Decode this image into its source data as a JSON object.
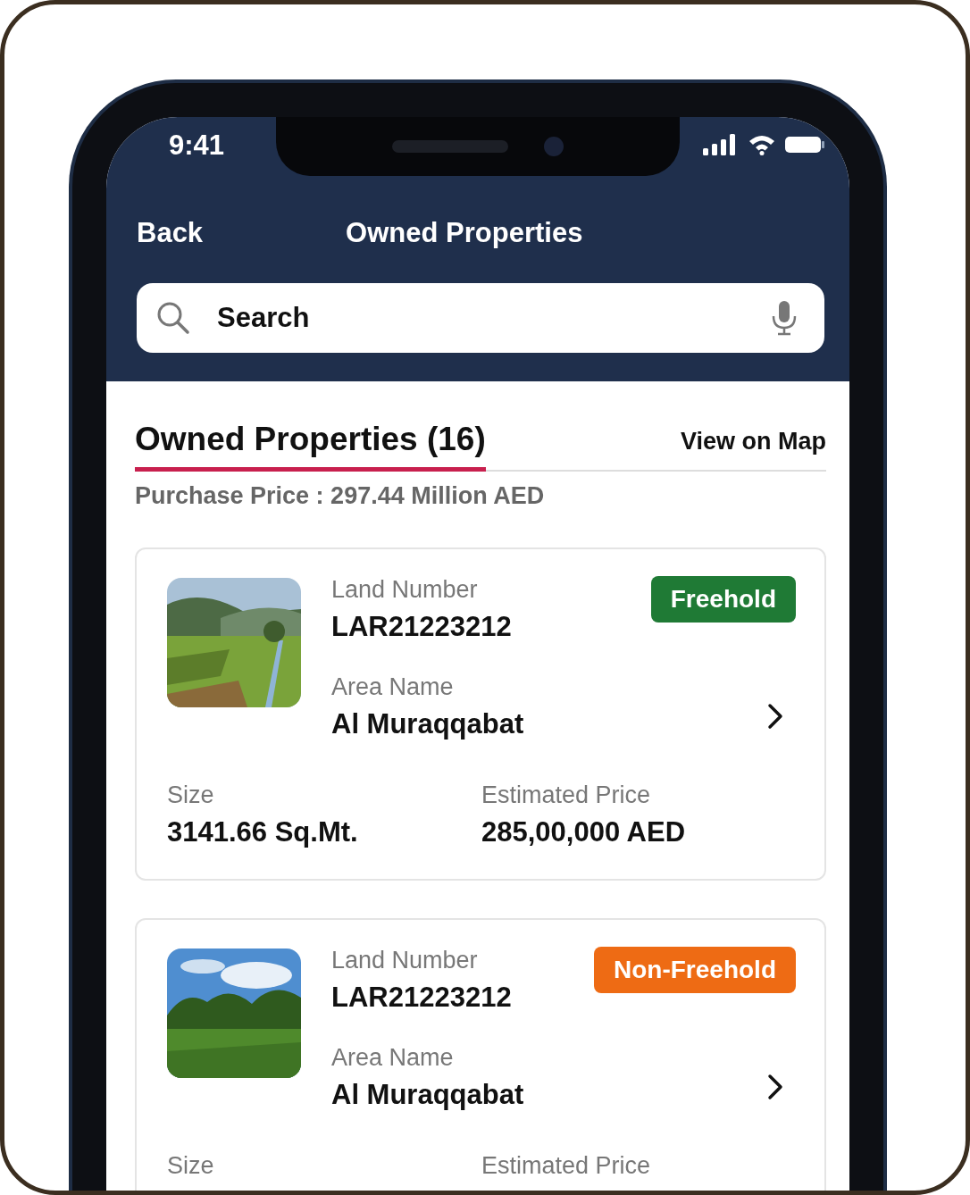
{
  "status_bar": {
    "time": "9:41"
  },
  "nav": {
    "back": "Back",
    "title": "Owned Properties"
  },
  "search": {
    "placeholder": "Search"
  },
  "section": {
    "title": "Owned Properties (16)",
    "link": "View on Map",
    "summary": "Purchase Price : 297.44 Million AED"
  },
  "properties": [
    {
      "land_label": "Land Number",
      "land_number": "LAR21223212",
      "area_label": "Area Name",
      "area_name": "Al Muraqqabat",
      "tenure": "Freehold",
      "color": "#1f7a35",
      "size_label": "Size",
      "size": "3141.66 Sq.Mt.",
      "price_label": "Estimated Price",
      "price": "285,00,000 AED"
    },
    {
      "land_label": "Land Number",
      "land_number": "LAR21223212",
      "area_label": "Area Name",
      "area_name": "Al Muraqqabat",
      "tenure": "Non-Freehold",
      "color": "#ee6b14",
      "size_label": "Size",
      "price_label": "Estimated Price"
    }
  ]
}
